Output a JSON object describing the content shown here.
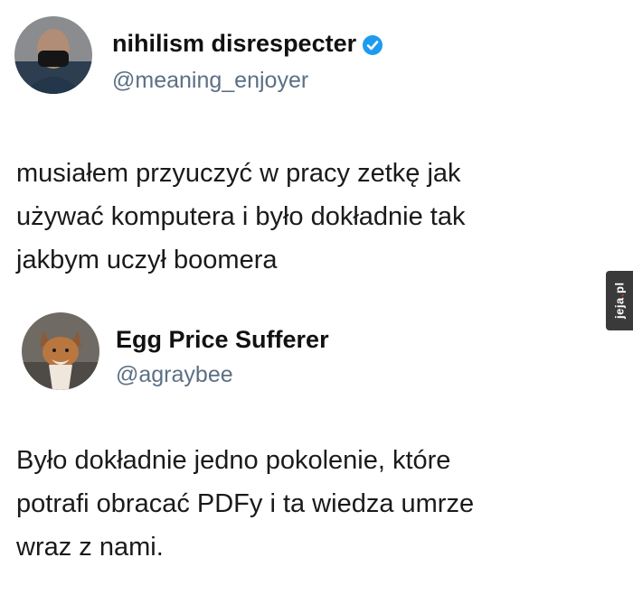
{
  "post1": {
    "display_name": "nihilism disrespecter",
    "handle": "@meaning_enjoyer",
    "verified": true,
    "text_lines": [
      "musiałem przyuczyć w pracy zetkę jak",
      "używać komputera i było dokładnie tak",
      "jakbym uczył boomera"
    ]
  },
  "post2": {
    "display_name": "Egg Price Sufferer",
    "handle": "@agraybee",
    "text_lines": [
      "Było dokładnie jedno pokolenie, które",
      "potrafi obracać PDFy i ta wiedza umrze",
      "wraz z nami."
    ]
  },
  "watermark": {
    "brand": "jeja",
    "dot": ".",
    "tld": "pl"
  },
  "colors": {
    "verified_badge": "#1d9bf0",
    "handle": "#5b7083",
    "watermark_bg": "#3a3a3a"
  }
}
